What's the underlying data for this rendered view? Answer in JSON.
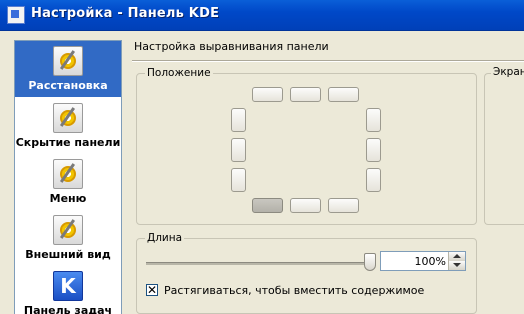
{
  "window": {
    "title": "Настройка - Панель KDE"
  },
  "sidebar": {
    "items": [
      {
        "label": "Расстановка",
        "icon": "gear-pen-icon",
        "selected": true
      },
      {
        "label": "Скрытие панели",
        "icon": "gear-pen-icon",
        "selected": false
      },
      {
        "label": "Меню",
        "icon": "gear-pen-icon",
        "selected": false
      },
      {
        "label": "Внешний вид",
        "icon": "gear-pen-icon",
        "selected": false
      },
      {
        "label": "Панель задач",
        "icon": "kde-icon",
        "selected": false
      }
    ]
  },
  "main": {
    "heading": "Настройка выравнивания панели",
    "position_group": {
      "legend": "Положение",
      "selected_position": "bottom-left"
    },
    "screen_group": {
      "legend": "Экран"
    },
    "length_group": {
      "legend": "Длина",
      "slider_value_percent": 100,
      "spin_value": "100%",
      "checkbox_label": "Растягиваться, чтобы вместить содержимое",
      "checkbox_checked": true,
      "checkbox_mark": "✕"
    }
  },
  "colors": {
    "title_bar": "#0a5fd8",
    "selection": "#316ac5",
    "window_bg": "#ece9d8"
  }
}
